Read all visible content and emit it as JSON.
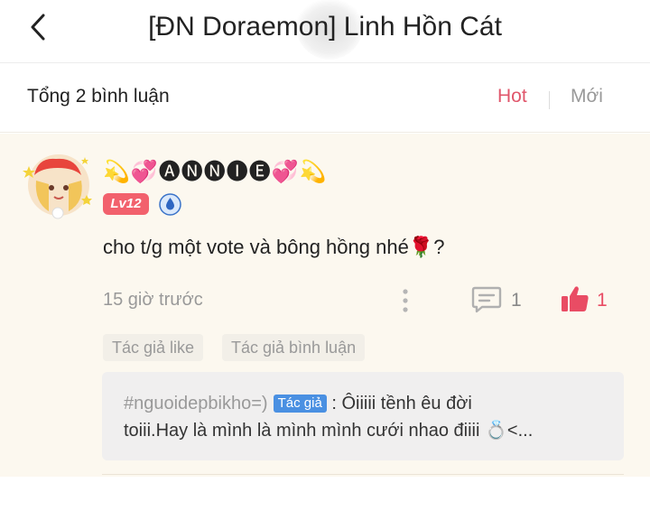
{
  "header": {
    "title": "[ĐN Doraemon] Linh Hồn Cát",
    "back_icon": "chevron-left-icon"
  },
  "subbar": {
    "total_label": "Tổng 2 bình luận",
    "sort_hot": "Hot",
    "sort_new": "Mới",
    "active_color": "#e0566b"
  },
  "comment": {
    "username": "💫💞🅐🅝🅝🅘🅔💞💫",
    "level": "Lv12",
    "content": "cho t/g một vote và bông hồng nhé🌹?",
    "time": "15 giờ trước",
    "reply_count": "1",
    "like_count": "1",
    "tags": [
      "Tác giả like",
      "Tác giả bình luận"
    ],
    "reply": {
      "user": "#nguoidepbikho=)",
      "author_badge": "Tác giả",
      "text_line1": " : Ôiiiii tềnh êu đời",
      "text_line2": "toiii.Hay là mình là mình mình cưới nhao điiii 💍<..."
    }
  }
}
